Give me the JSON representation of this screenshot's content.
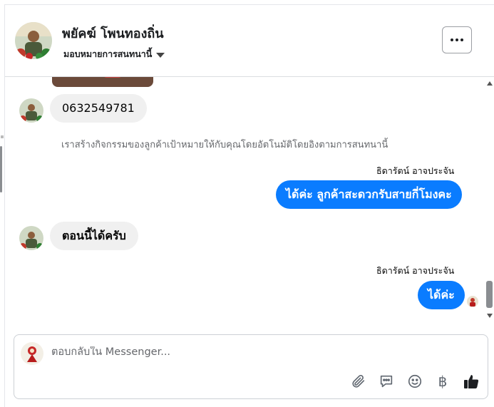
{
  "header": {
    "contact_name": "พยัคฆ์ โพนทองถิ่น",
    "assign_label": "มอบหมายการสนทนานี้",
    "more_icon": "more-horizontal-icon"
  },
  "thread": {
    "messages": [
      {
        "direction": "incoming",
        "text": "0632549781"
      },
      {
        "direction": "system",
        "text": "เราสร้างกิจกรรมของลูกค้าเป้าหมายให้กับคุณโดยอัตโนมัติโดยอิงตามการสนทนานี้"
      },
      {
        "direction": "outgoing",
        "sender": "ธิดารัตน์ อาจประจัน",
        "text": "ได้ค่ะ ลูกค้าสะดวกรับสายกี่โมงคะ"
      },
      {
        "direction": "incoming",
        "text": "ตอนนี้ได้ครับ"
      },
      {
        "direction": "outgoing",
        "sender": "ธิดารัตน์ อาจประจัน",
        "text": "ได้ค่ะ"
      }
    ]
  },
  "composer": {
    "placeholder": "ตอบกลับใน Messenger...",
    "tools": [
      "paperclip-icon",
      "chat-bubble-icon",
      "emoji-icon",
      "baht-icon",
      "thumbs-up-icon"
    ],
    "baht_symbol": "฿"
  },
  "colors": {
    "outgoing_bubble": "#0a7cff",
    "incoming_bubble": "#f0f0f0",
    "thumbs_up": "#1c1e21"
  }
}
